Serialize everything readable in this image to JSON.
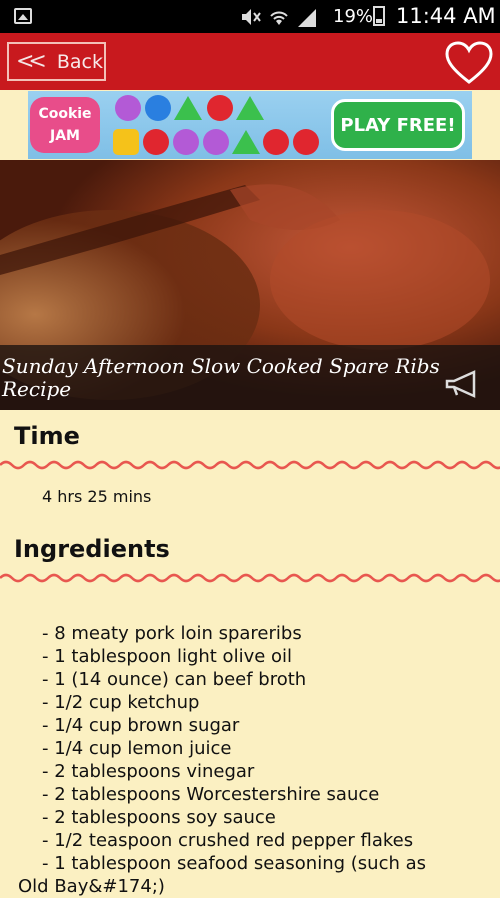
{
  "status_bar": {
    "battery": "19%",
    "time": "11:44 AM"
  },
  "app_bar": {
    "back_label": "Back"
  },
  "ad": {
    "logo_line1": "Cookie",
    "logo_line2": "JAM",
    "cta": "PLAY FREE!"
  },
  "recipe": {
    "title": "Sunday Afternoon Slow Cooked Spare Ribs Recipe",
    "time_heading": "Time",
    "time_value": "4 hrs 25 mins",
    "ingredients_heading": "Ingredients",
    "ingredients": [
      "-  8 meaty pork loin spareribs",
      "-  1 tablespoon light olive oil",
      "-  1 (14 ounce) can beef broth",
      "-  1/2 cup ketchup",
      "-  1/4 cup brown sugar",
      "-  1/4 cup lemon juice",
      "-  2 tablespoons vinegar",
      "-  2 tablespoons Worcestershire sauce",
      "-  2 tablespoons soy sauce",
      "-  1/2 teaspoon crushed red pepper flakes",
      "-  1 tablespoon seafood seasoning (such as",
      "Old Bay&#174;)"
    ]
  },
  "colors": {
    "accent": "#c8191e",
    "background": "#fbf0c2",
    "wave": "#e8574f"
  }
}
